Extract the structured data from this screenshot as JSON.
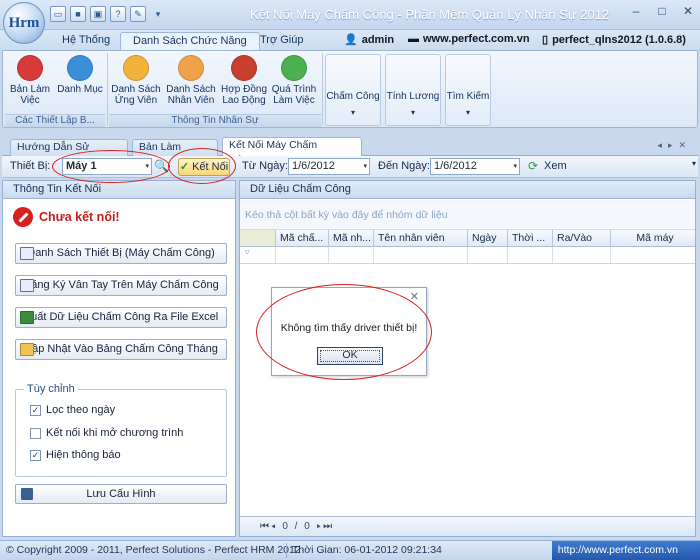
{
  "window": {
    "title": "Kết Nối Máy Chấm Công - Phần Mềm Quản Lý Nhân Sự 2012",
    "logo_text": "Hrm"
  },
  "ribbon_tabs": [
    {
      "label": "Hệ Thống"
    },
    {
      "label": "Danh Sách Chức Năng"
    },
    {
      "label": "Trợ Giúp"
    }
  ],
  "user_info": {
    "username": "admin",
    "website": "www.perfect.com.vn",
    "database": "perfect_qlns2012 (1.0.6.8)"
  },
  "ribbon": {
    "group1": {
      "label": "Các Thiết Lập B...",
      "buttons": [
        {
          "line1": "Bản Làm",
          "line2": "Việc",
          "color": "#d73a3a"
        },
        {
          "line1": "Danh Mục",
          "line2": "",
          "color": "#3b8ed8"
        }
      ]
    },
    "group2": {
      "label": "Thông Tin Nhân Sự",
      "buttons": [
        {
          "line1": "Danh Sách",
          "line2": "Ứng Viên",
          "color": "#f2b23b"
        },
        {
          "line1": "Danh Sách",
          "line2": "Nhân Viên",
          "color": "#f0a24a"
        },
        {
          "line1": "Hợp Đồng",
          "line2": "Lao Động",
          "color": "#c7402f"
        },
        {
          "line1": "Quá Trình",
          "line2": "Làm Việc",
          "color": "#4caf50"
        }
      ]
    },
    "dropdowns": [
      {
        "label": "Chấm Công"
      },
      {
        "label": "Tính Lương"
      },
      {
        "label": "Tìm Kiếm"
      }
    ]
  },
  "doc_tabs": [
    {
      "label": "Hướng Dẫn Sử Dụng"
    },
    {
      "label": "Bản Làm Việc"
    },
    {
      "label": "Kết Nối Máy Chấm Công"
    }
  ],
  "toolbar": {
    "device_label": "Thiết Bị:",
    "device_value": "Máy 1",
    "connect_label": "Kết Nối",
    "from_label": "Từ Ngày:",
    "from_value": "1/6/2012",
    "to_label": "Đến Ngày:",
    "to_value": "1/6/2012",
    "view_label": "Xem"
  },
  "left_panel": {
    "title": "Thông Tin Kết Nối",
    "status": "Chưa kết nối!",
    "actions": [
      {
        "label": "Danh Sách Thiết Bị (Máy Chấm Công)"
      },
      {
        "label": "Đăng Ký Vân Tay Trên Máy Chấm Công"
      },
      {
        "label": "Xuất Dữ Liệu Chấm Công Ra File Excel"
      },
      {
        "label": "Cập Nhật Vào Bảng Chấm Công Tháng"
      }
    ],
    "options_title": "Tùy chỉnh",
    "options": [
      {
        "label": "Lọc theo ngày",
        "checked": "✓"
      },
      {
        "label": "Kết nối khi mở chương trình",
        "checked": ""
      },
      {
        "label": "Hiện thông báo",
        "checked": "✓"
      }
    ],
    "save_label": "Lưu Cấu Hình"
  },
  "right_panel": {
    "title": "Dữ Liệu Chấm Công",
    "group_hint": "Kéo thả cột bất kỳ vào đây để nhóm dữ liệu",
    "columns": [
      "",
      "Mã chấ...",
      "Mã nh...",
      "Tên nhân viên",
      "Ngày",
      "Thời ...",
      "Ra/Vào",
      "Mã máy"
    ],
    "pager": "0 / 0"
  },
  "dialog": {
    "message": "Không tìm thấy driver thiết bị!",
    "ok_label": "OK"
  },
  "statusbar": {
    "copyright": "© Copyright 2009 - 2011, Perfect Solutions - Perfect HRM 2012",
    "time": "Thời Gian: 06-01-2012 09:21:34",
    "url": "http://www.perfect.com.vn"
  }
}
